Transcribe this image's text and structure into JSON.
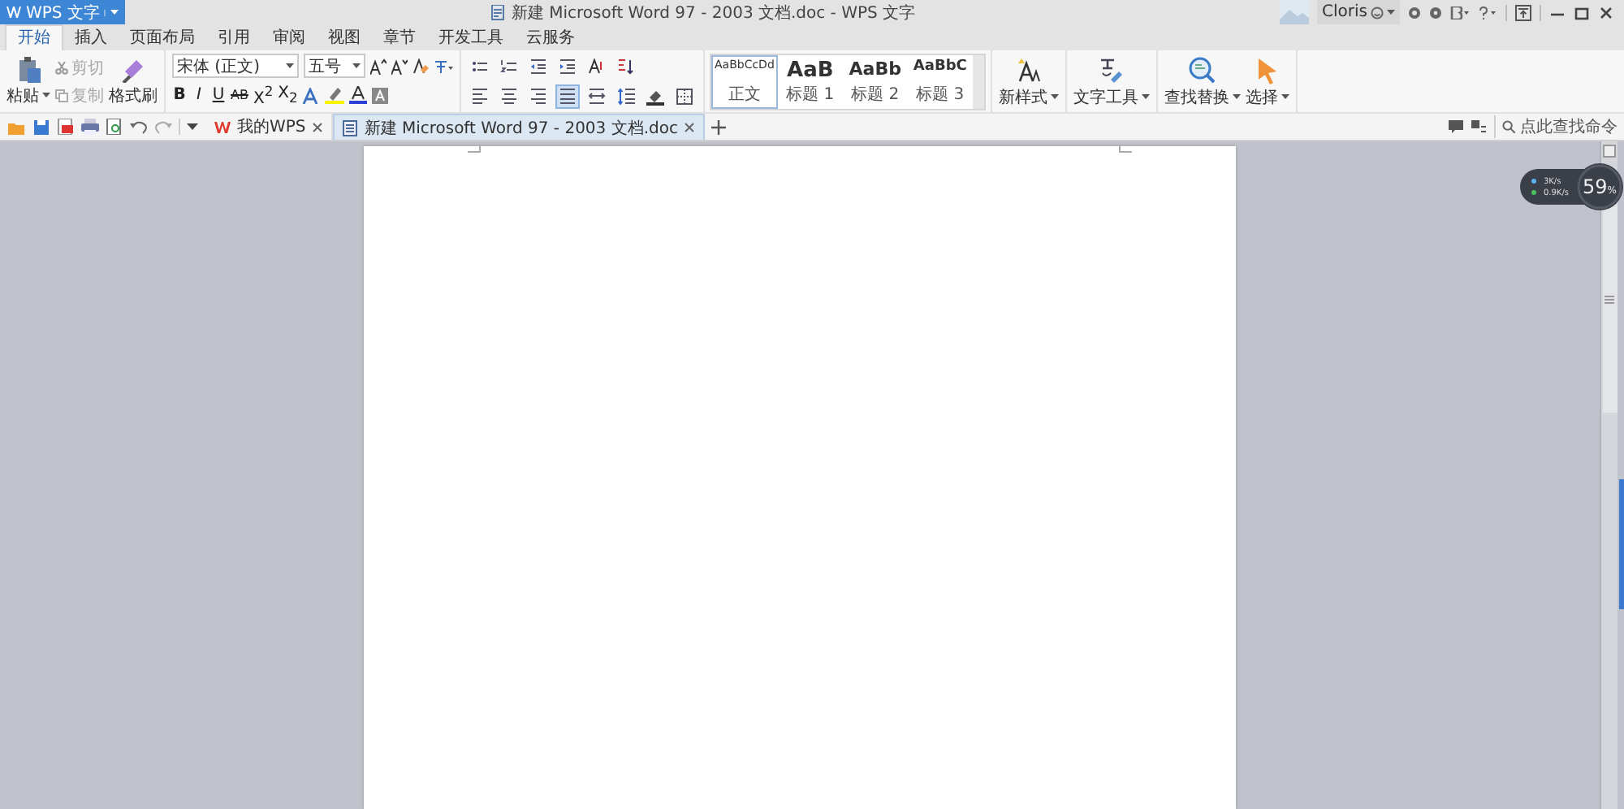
{
  "app_menu": {
    "label": "WPS 文字"
  },
  "window": {
    "title": "新建 Microsoft Word 97 - 2003 文档.doc - WPS 文字"
  },
  "account": {
    "user": "Cloris"
  },
  "ribbon_tabs": [
    {
      "label": "开始",
      "selected": true
    },
    {
      "label": "插入",
      "selected": false
    },
    {
      "label": "页面布局",
      "selected": false
    },
    {
      "label": "引用",
      "selected": false
    },
    {
      "label": "审阅",
      "selected": false
    },
    {
      "label": "视图",
      "selected": false
    },
    {
      "label": "章节",
      "selected": false
    },
    {
      "label": "开发工具",
      "selected": false
    },
    {
      "label": "云服务",
      "selected": false
    }
  ],
  "clipboard": {
    "paste": "粘贴",
    "cut": {
      "label": "剪切",
      "disabled": true
    },
    "copy": {
      "label": "复制",
      "disabled": true
    },
    "format_painter": "格式刷"
  },
  "font": {
    "name": "宋体 (正文)",
    "size": "五号",
    "format_buttons": [
      {
        "kind": "bold",
        "label": "B"
      },
      {
        "kind": "italic",
        "label": "I"
      },
      {
        "kind": "underline",
        "label": "U"
      },
      {
        "kind": "strike",
        "label": "AB"
      },
      {
        "kind": "superscript",
        "label": "X$^{2}$"
      },
      {
        "kind": "subscript",
        "label": "X$_{2}$"
      }
    ]
  },
  "paragraph": {
    "buttons": [
      {
        "kind": "bullets",
        "selected": false
      },
      {
        "kind": "numbering",
        "selected": false
      },
      {
        "kind": "outdent",
        "selected": false
      },
      {
        "kind": "indent",
        "selected": false
      },
      {
        "kind": "case",
        "selected": false
      },
      {
        "kind": "sort",
        "selected": false
      },
      {
        "kind": "align-left",
        "selected": false
      },
      {
        "kind": "align-center",
        "selected": false
      },
      {
        "kind": "align-right",
        "selected": false
      },
      {
        "kind": "justify",
        "selected": true
      },
      {
        "kind": "distribute",
        "selected": false
      },
      {
        "kind": "line-spacing",
        "selected": false
      },
      {
        "kind": "shading",
        "selected": false
      },
      {
        "kind": "borders",
        "selected": false
      }
    ]
  },
  "styles": [
    {
      "sample": "AaBbCcDd",
      "label": "正文",
      "selected": true
    },
    {
      "sample": "AaB",
      "label": "标题 1",
      "selected": false
    },
    {
      "sample": "AaBb",
      "label": "标题 2",
      "selected": false
    },
    {
      "sample": "AaBbC",
      "label": "标题 3",
      "selected": false
    }
  ],
  "tools": [
    {
      "kind": "new-style",
      "label": "新样式"
    },
    {
      "kind": "text-tools",
      "label": "文字工具"
    },
    {
      "kind": "find",
      "label": "查找替换"
    },
    {
      "kind": "select",
      "label": "选择"
    }
  ],
  "doc_tabs": [
    {
      "label": "我的WPS",
      "selected": false
    },
    {
      "label": "新建 Microsoft Word 97 - 2003 文档.doc",
      "selected": true
    }
  ],
  "command_search": {
    "placeholder": "点此查找命令"
  },
  "speed_widget": {
    "upload": "3K/s",
    "download": "0.9K/s",
    "value": "59",
    "unit": "%"
  }
}
